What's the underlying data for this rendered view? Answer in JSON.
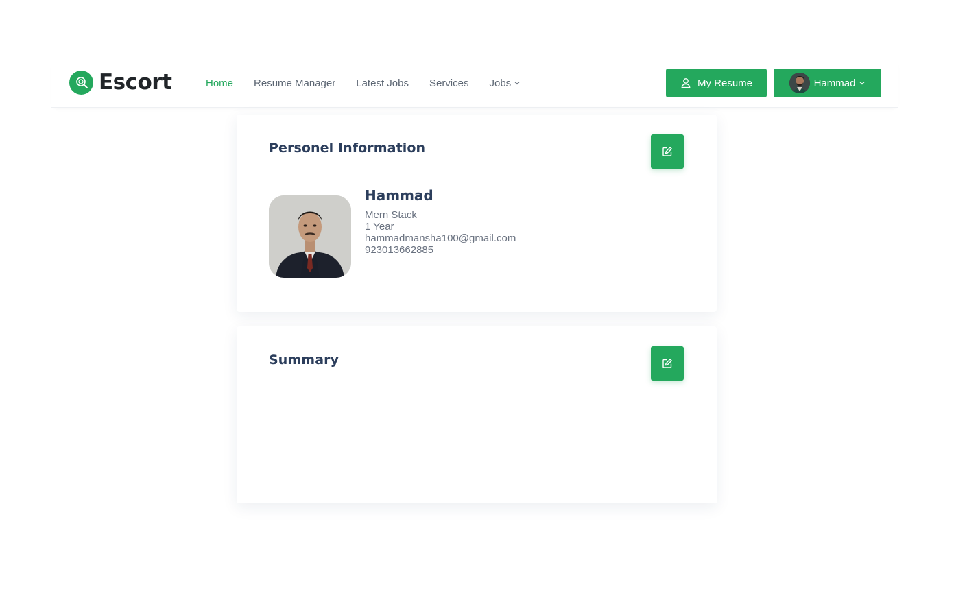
{
  "brand": {
    "name": "Escort",
    "accent_color": "#24a85d",
    "logo_icon": "search-pin-icon"
  },
  "nav": {
    "items": [
      {
        "label": "Home",
        "active": true
      },
      {
        "label": "Resume Manager",
        "active": false
      },
      {
        "label": "Latest Jobs",
        "active": false
      },
      {
        "label": "Services",
        "active": false
      },
      {
        "label": "Jobs",
        "active": false,
        "has_dropdown": true
      }
    ]
  },
  "header_actions": {
    "resume_button": {
      "label": "My Resume",
      "icon": "user-icon"
    },
    "user_menu": {
      "name": "Hammad",
      "icon": "chevron-down-icon"
    }
  },
  "personal_info": {
    "title": "Personel Information",
    "edit_icon": "edit-icon",
    "name": "Hammad",
    "role": "Mern Stack",
    "experience": "1 Year",
    "email": "hammadmansha100@gmail.com",
    "phone": "923013662885"
  },
  "summary": {
    "title": "Summary",
    "edit_icon": "edit-icon"
  }
}
